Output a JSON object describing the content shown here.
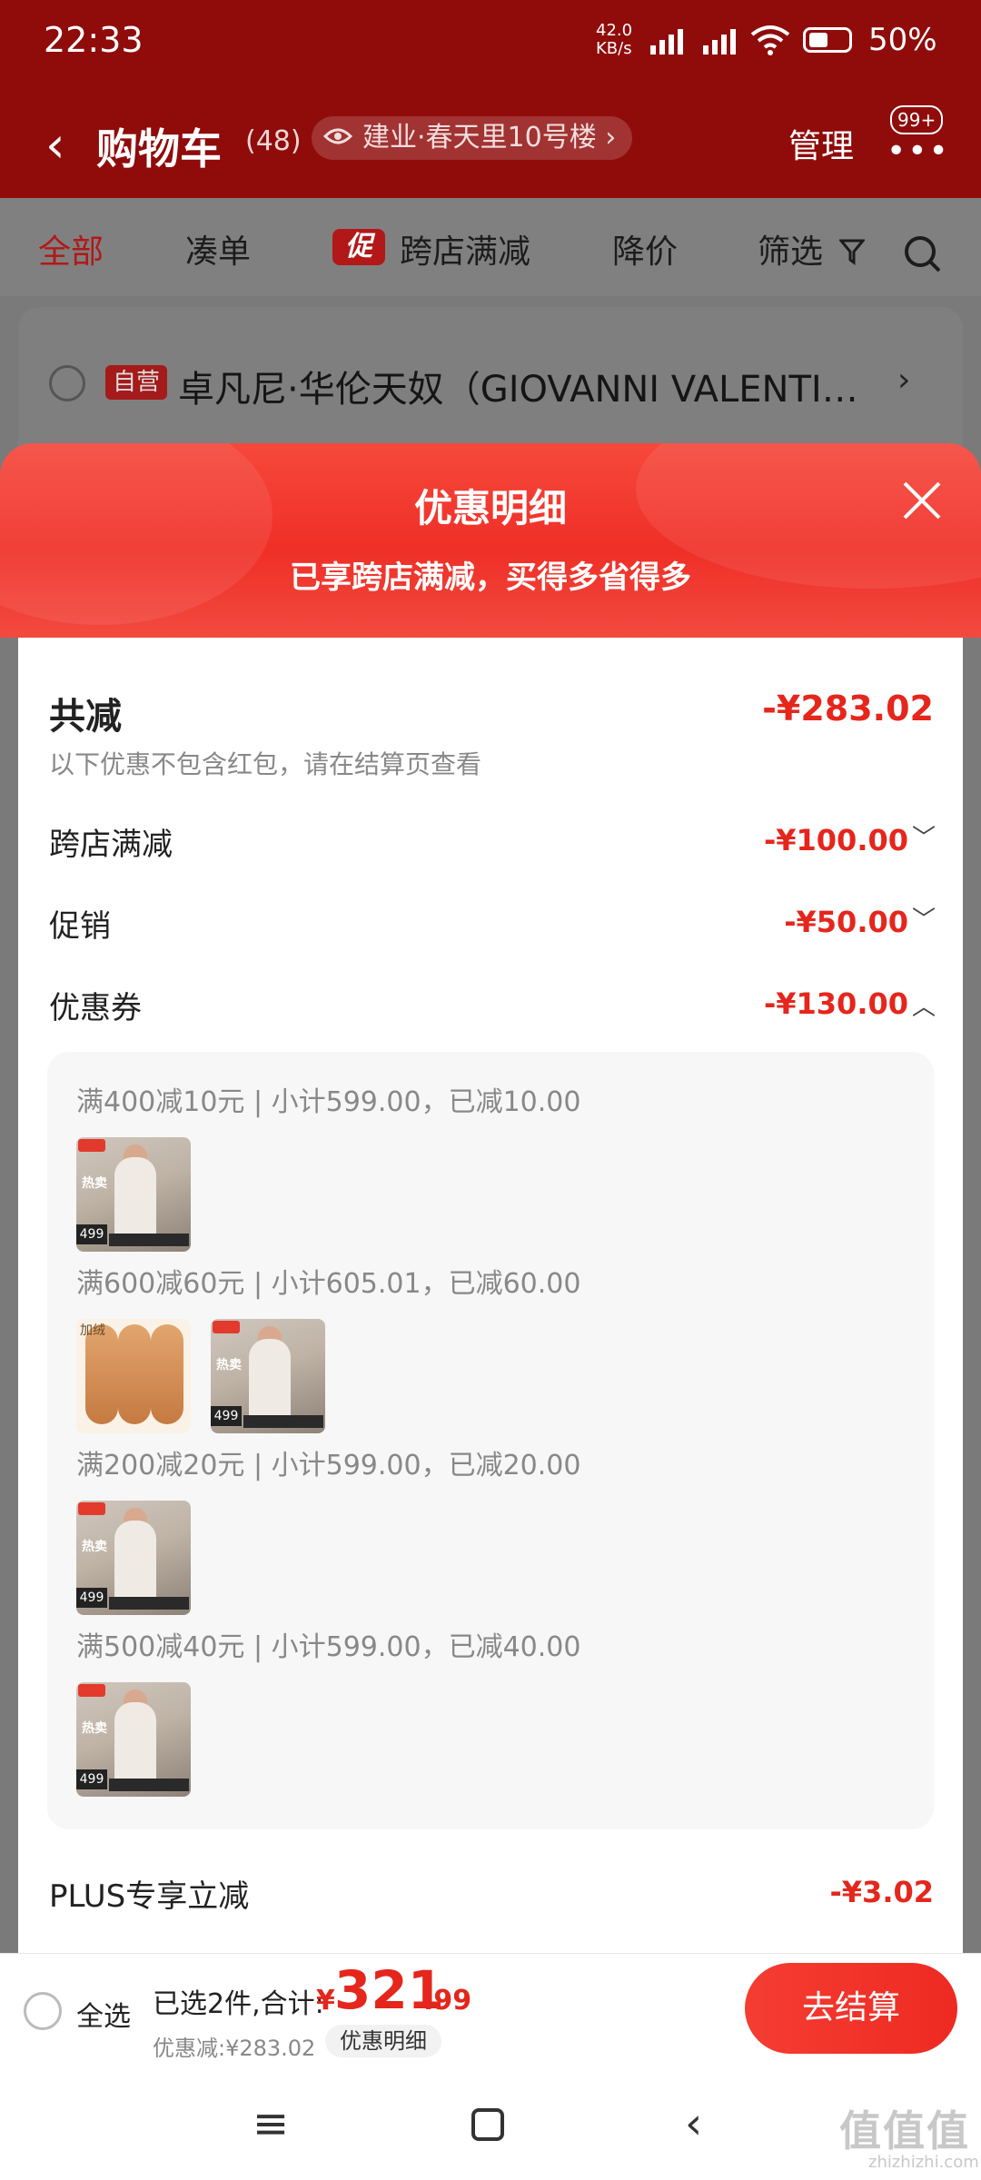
{
  "status_bar": {
    "time": "22:33",
    "net_speed": "42.0",
    "net_unit": "KB/s",
    "battery_pct": "50%"
  },
  "header": {
    "title": "购物车",
    "count": "(48)",
    "address": "建业·春天里10号楼",
    "manage": "管理",
    "badge": "99+"
  },
  "tabs": [
    {
      "label": "全部",
      "active": true
    },
    {
      "label": "凑单"
    },
    {
      "label": "跨店满减",
      "chip": "促"
    },
    {
      "label": "降价"
    },
    {
      "label": "筛选"
    }
  ],
  "store_card": {
    "badge": "自营",
    "name": "卓凡尼·华伦天奴（GIOVANNI VALENTI…"
  },
  "sheet": {
    "title": "优惠明细",
    "subtitle": "已享跨店满减，买得多省得多",
    "total_label": "共减",
    "total_amount": "-¥283.02",
    "note": "以下优惠不包含红包，请在结算页查看",
    "rows": [
      {
        "label": "跨店满减",
        "amount": "-¥100.00",
        "caret": "﹀"
      },
      {
        "label": "促销",
        "amount": "-¥50.00",
        "caret": "﹀"
      },
      {
        "label": "优惠券",
        "amount": "-¥130.00",
        "caret": "︿"
      }
    ],
    "coupons": [
      {
        "text": "满400减10元 | 小计599.00，已减10.00"
      },
      {
        "text": "满600减60元 | 小计605.01，已减60.00"
      },
      {
        "text": "满200减20元 | 小计599.00，已减20.00"
      },
      {
        "text": "满500减40元 | 小计599.00，已减40.00"
      }
    ],
    "plus_label": "PLUS专享立减",
    "plus_amount": "-¥3.02"
  },
  "thumb_text": {
    "price": "499",
    "hot": "热卖",
    "insole": "加绒"
  },
  "bottom": {
    "select_all": "全选",
    "selected": "已选2件,合计:",
    "yen": "¥",
    "integer": "321",
    "cents": ".99",
    "discount": "优惠减:¥283.02",
    "detail_button": "优惠明细",
    "checkout": "去结算"
  },
  "watermark": {
    "main": "值值值",
    "sub": "zhizhizhi.com"
  },
  "colors": {
    "accent": "#e5261c",
    "header": "#8f0c0b"
  }
}
